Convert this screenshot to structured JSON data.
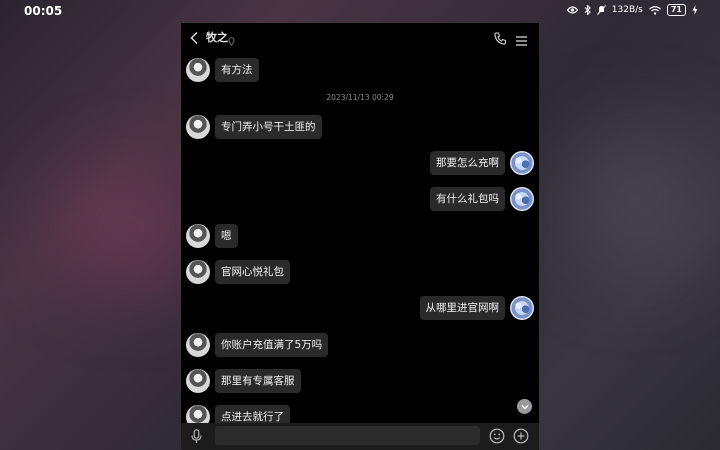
{
  "status_bar": {
    "time": "00:05",
    "net_speed": "132B/s",
    "battery": "71"
  },
  "chat": {
    "contact_name": "牧之",
    "messages": [
      {
        "side": "left",
        "text": "有方法"
      },
      {
        "type": "timestamp",
        "text": "2023/11/13 00:29"
      },
      {
        "side": "left",
        "text": "专门弄小号干土匪的"
      },
      {
        "side": "right",
        "text": "那要怎么充啊"
      },
      {
        "side": "right",
        "text": "有什么礼包吗"
      },
      {
        "side": "left",
        "text": "嗯"
      },
      {
        "side": "left",
        "text": "官网心悦礼包"
      },
      {
        "side": "right",
        "text": "从哪里进官网啊"
      },
      {
        "side": "left",
        "text": "你账户充值满了5万吗"
      },
      {
        "side": "left",
        "text": "那里有专属客服"
      },
      {
        "side": "left",
        "text": "点进去就行了"
      }
    ]
  },
  "input": {
    "value": "",
    "placeholder": ""
  },
  "colors": {
    "bubble_bg": "#2a2a2a",
    "chat_bg": "#000000",
    "input_bar_bg": "#1c1c1c"
  },
  "icons": {
    "back": "chevron-left-icon",
    "phone": "phone-icon",
    "menu": "hamburger-menu-icon",
    "mic": "microphone-icon",
    "emoji": "smiley-icon",
    "plus": "plus-circle-icon",
    "scroll": "chevron-down-icon"
  }
}
